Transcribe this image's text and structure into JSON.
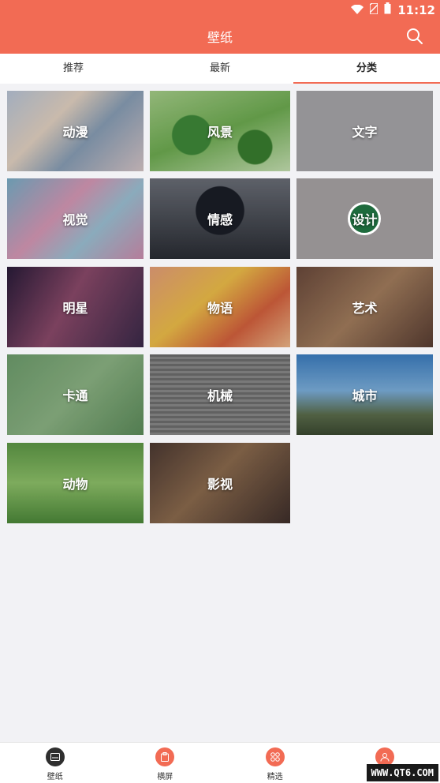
{
  "status_bar": {
    "time": "11:12"
  },
  "header": {
    "title": "壁纸"
  },
  "tabs": [
    {
      "label": "推荐",
      "active": false
    },
    {
      "label": "最新",
      "active": false
    },
    {
      "label": "分类",
      "active": true
    }
  ],
  "categories": [
    {
      "label": "动漫",
      "class": "c-anime"
    },
    {
      "label": "风景",
      "class": "c-scene"
    },
    {
      "label": "文字",
      "class": "c-text"
    },
    {
      "label": "视觉",
      "class": "c-vision"
    },
    {
      "label": "情感",
      "class": "c-emotion"
    },
    {
      "label": "设计",
      "class": "c-design"
    },
    {
      "label": "明星",
      "class": "c-star"
    },
    {
      "label": "物语",
      "class": "c-story"
    },
    {
      "label": "艺术",
      "class": "c-art"
    },
    {
      "label": "卡通",
      "class": "c-card"
    },
    {
      "label": "机械",
      "class": "c-mech"
    },
    {
      "label": "城市",
      "class": "c-city"
    },
    {
      "label": "动物",
      "class": "c-animal"
    },
    {
      "label": "影视",
      "class": "c-film"
    }
  ],
  "bottom_nav": [
    {
      "label": "壁纸",
      "icon": "wallpaper-icon",
      "color": "#2f2f2f"
    },
    {
      "label": "横屏",
      "icon": "landscape-icon",
      "color": "#f26b54"
    },
    {
      "label": "精选",
      "icon": "grid-dots-icon",
      "color": "#f26b54"
    },
    {
      "label": "",
      "icon": "user-icon",
      "color": "#f26b54"
    }
  ],
  "watermark": "WWW.QT6.COM",
  "colors": {
    "accent": "#f26b54",
    "background": "#f2f2f5"
  }
}
